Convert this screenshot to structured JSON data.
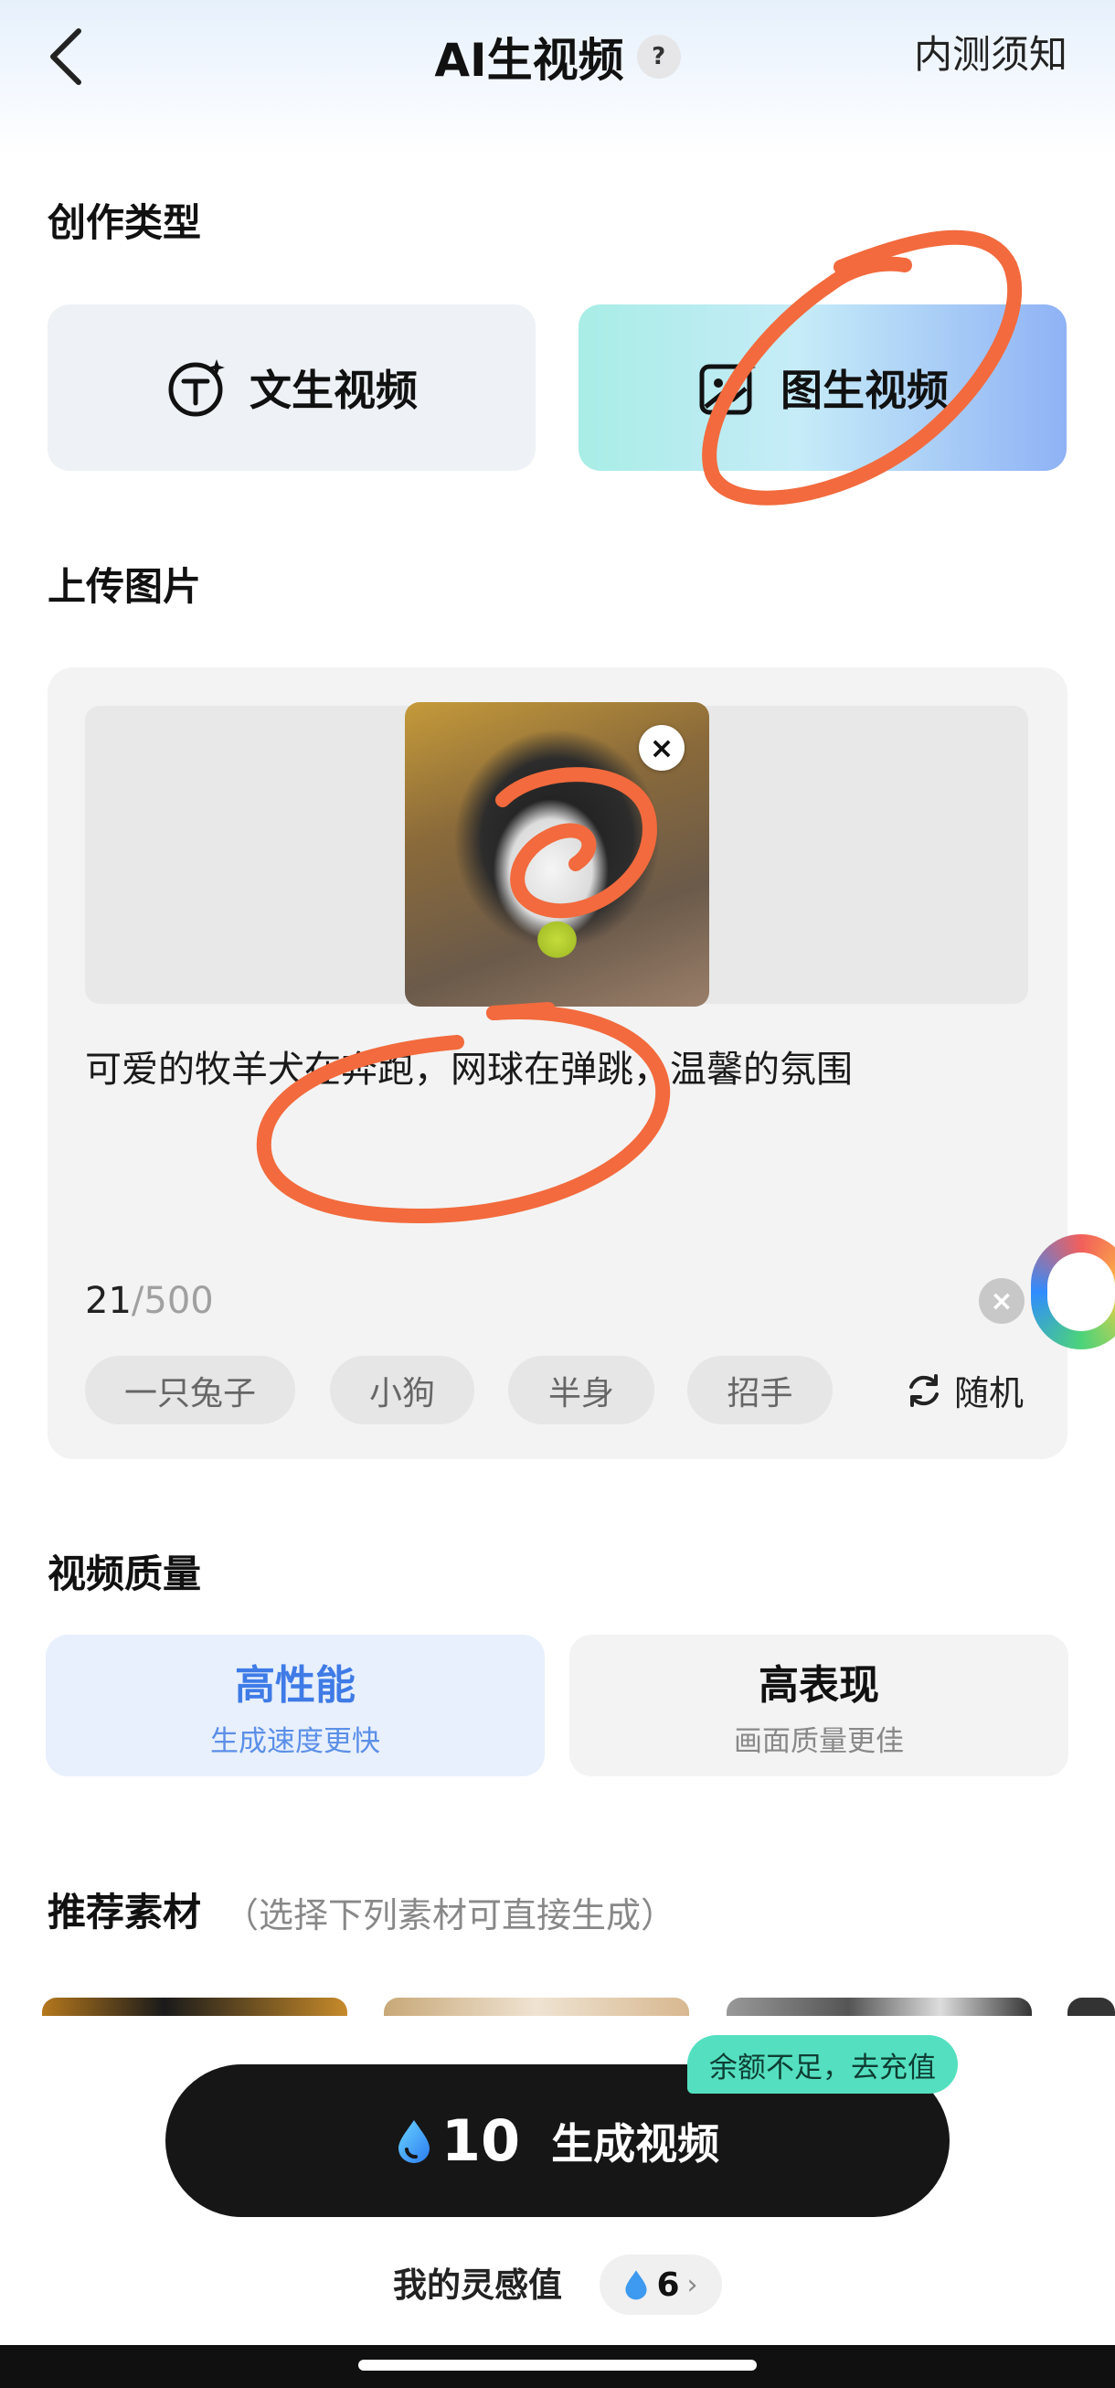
{
  "header": {
    "title": "AI生视频",
    "help_icon": "?",
    "notice": "内测须知"
  },
  "creation_type": {
    "label": "创作类型",
    "options": [
      {
        "label": "文生视频",
        "icon": "text-to-video-icon"
      },
      {
        "label": "图生视频",
        "icon": "image-to-video-icon",
        "selected": true
      }
    ]
  },
  "upload": {
    "label": "上传图片",
    "close_icon": "×",
    "prompt": "可爱的牧羊犬在奔跑，网球在弹跳，温馨的氛围",
    "char_count": "21",
    "char_max": "/500",
    "clear_icon": "×",
    "chips": [
      "一只兔子",
      "小狗",
      "半身",
      "招手"
    ],
    "random_label": "随机"
  },
  "quality": {
    "label": "视频质量",
    "options": [
      {
        "title": "高性能",
        "subtitle": "生成速度更快",
        "selected": true
      },
      {
        "title": "高表现",
        "subtitle": "画面质量更佳",
        "selected": false
      }
    ]
  },
  "recommend": {
    "label": "推荐素材",
    "subtitle": "（选择下列素材可直接生成）"
  },
  "generate": {
    "cost": "10",
    "label": "生成视频",
    "balance_tag": "余额不足，去充值"
  },
  "inspiration": {
    "label": "我的灵感值",
    "value": "6",
    "chevron": "›"
  },
  "colors": {
    "primary_blue": "#3f7be6",
    "button_dark": "#161616",
    "balance_green": "#54e0c0"
  }
}
